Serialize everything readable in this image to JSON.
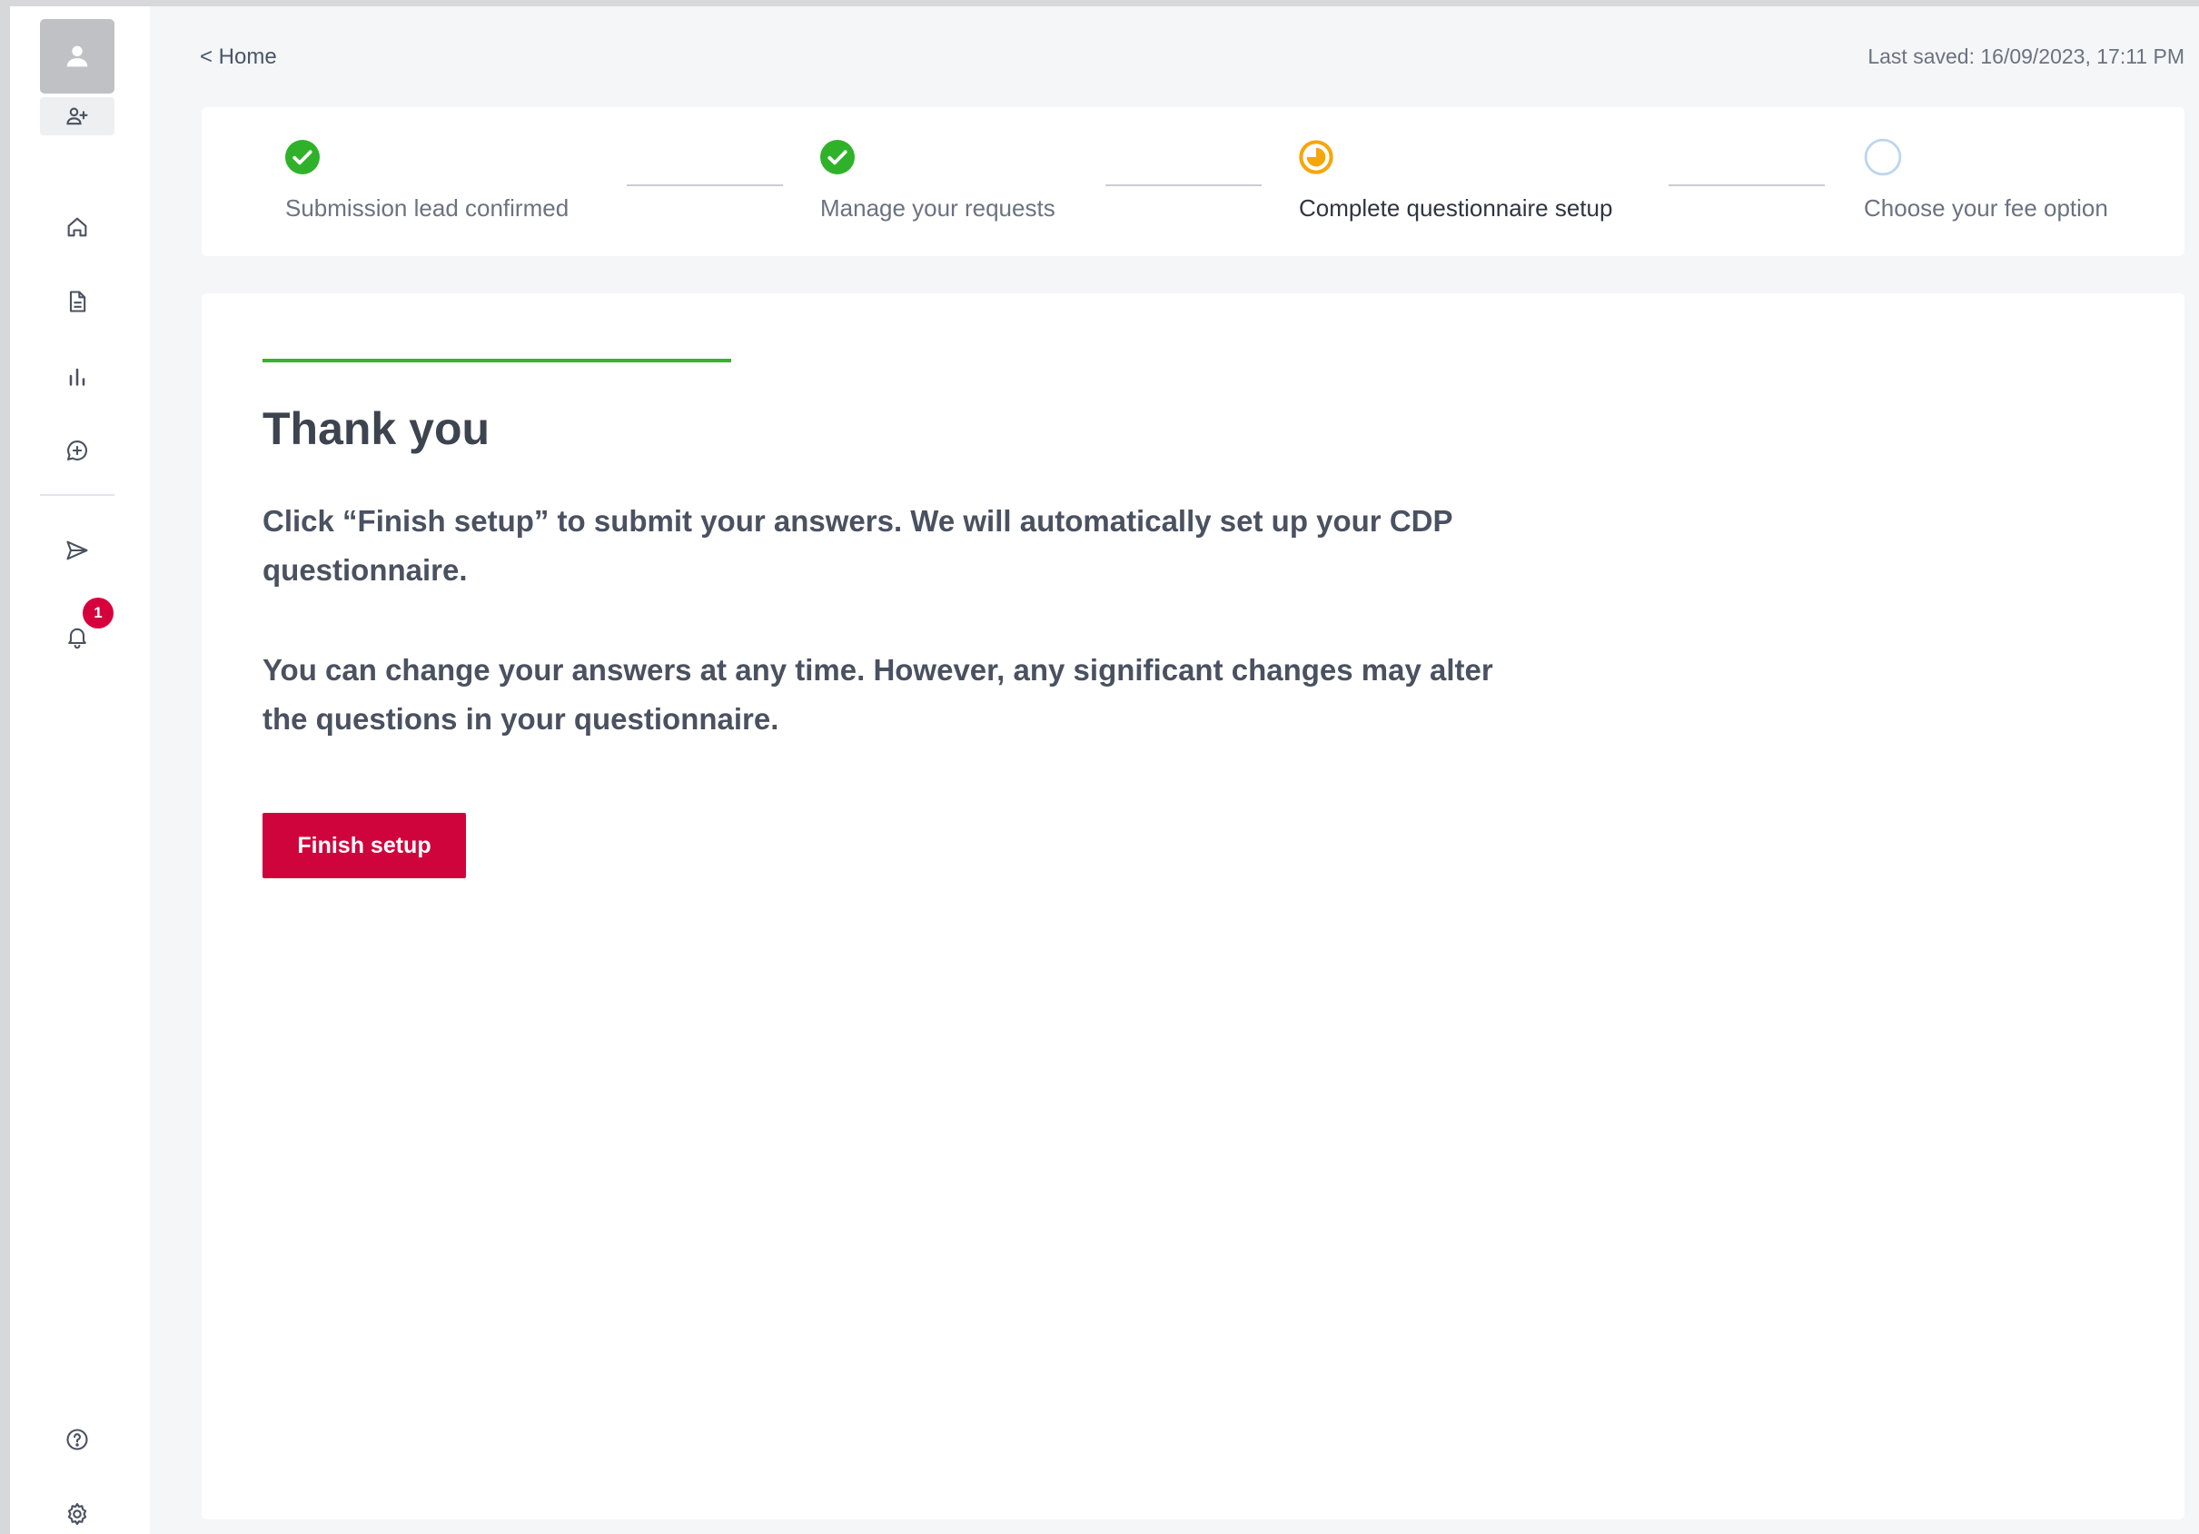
{
  "breadcrumb": {
    "label": "< Home"
  },
  "header": {
    "last_saved": "Last saved: 16/09/2023, 17:11 PM"
  },
  "sidebar": {
    "badge_count": "1",
    "items": [
      {
        "icon": "home-icon"
      },
      {
        "icon": "document-icon"
      },
      {
        "icon": "bar-chart-icon"
      },
      {
        "icon": "add-comment-icon"
      },
      {
        "icon": "send-icon"
      },
      {
        "icon": "bell-icon"
      },
      {
        "icon": "help-icon"
      },
      {
        "icon": "gear-icon"
      }
    ]
  },
  "stepper": {
    "steps": [
      {
        "label": "Submission lead confirmed",
        "status": "complete"
      },
      {
        "label": "Manage your requests",
        "status": "complete"
      },
      {
        "label": "Complete questionnaire setup",
        "status": "in-progress"
      },
      {
        "label": "Choose your fee option",
        "status": "pending"
      }
    ]
  },
  "main": {
    "title": "Thank you",
    "paragraph1": "Click “Finish setup” to submit your answers. We will automatically set up your CDP questionnaire.",
    "paragraph2": "You can change your answers at any time. However, any significant changes may alter the questions in your questionnaire.",
    "finish_label": "Finish setup"
  },
  "colors": {
    "accent_green": "#3ab02f",
    "step_complete": "#2fb22a",
    "step_in_progress": "#f5a60b",
    "step_pending": "#bcd6ee",
    "primary_button": "#d0043c",
    "badge": "#d6003c"
  }
}
